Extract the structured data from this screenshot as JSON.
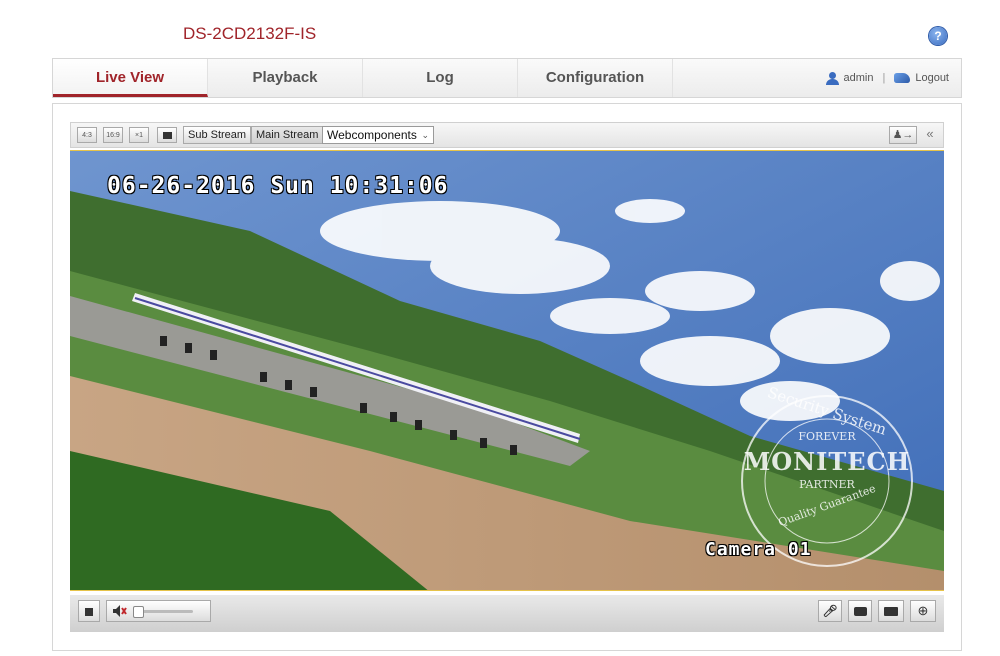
{
  "header": {
    "model": "DS-2CD2132F-IS",
    "help_glyph": "?"
  },
  "nav": {
    "tabs": [
      {
        "label": "Live View",
        "active": true
      },
      {
        "label": "Playback",
        "active": false
      },
      {
        "label": "Log",
        "active": false
      },
      {
        "label": "Configuration",
        "active": false
      }
    ],
    "user": "admin",
    "separator": "|",
    "logout": "Logout"
  },
  "toolbar": {
    "ratio_4_3": "4:3",
    "ratio_16_9": "16:9",
    "ratio_1_1": "×1",
    "sub_stream": "Sub Stream",
    "main_stream": "Main Stream",
    "plugin_select": "Webcomponents",
    "collapse": "«"
  },
  "video": {
    "osd_datetime": "06-26-2016 Sun 10:31:06",
    "osd_camera": "Camera 01",
    "watermark": {
      "top": "Security System",
      "line1": "FOREVER",
      "brand": "MONITECH",
      "line2": "PARTNER",
      "bottom": "Quality Guarantee"
    }
  },
  "controls": {
    "volume_level": 0.0
  },
  "colors": {
    "accent": "#a0242a",
    "link_blue": "#3a6cc0"
  }
}
